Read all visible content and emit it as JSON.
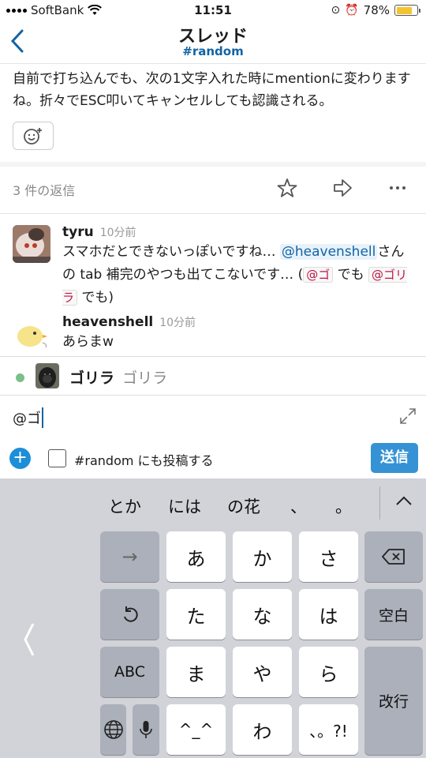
{
  "status_bar": {
    "carrier": "SoftBank",
    "time": "11:51",
    "battery": "78%"
  },
  "nav": {
    "title": "スレッド",
    "channel": "#random"
  },
  "parent_message": {
    "text": "自前で打ち込んでも、次の1文字入れた時にmentionに変わりますね。折々でESC叩いてキャンセルしても認識される。"
  },
  "thread_bar": {
    "reply_count": "3 件の返信"
  },
  "messages": [
    {
      "user": "tyru",
      "time": "10分前",
      "p1": "スマホだとできないっぽいですね… ",
      "mention": "@heavenshell",
      "p2": "さんの tab 補完のやつも出てこないです… (",
      "code1": "@ゴ",
      "p3": " でも ",
      "code2": "@ゴリラ",
      "p4": " でも)"
    },
    {
      "user": "heavenshell",
      "time": "10分前",
      "text": "あらまw"
    }
  ],
  "suggestion": {
    "display_name": "ゴリラ",
    "full_name": "ゴリラ"
  },
  "compose": {
    "text": "@ゴ",
    "also_post_label": "#random にも投稿する",
    "send_label": "送信"
  },
  "keyboard": {
    "candidates": [
      "とか",
      "には",
      "の花",
      "、",
      "。"
    ],
    "row1": [
      "→",
      "あ",
      "か",
      "さ"
    ],
    "row2": [
      "た",
      "な",
      "は",
      "空白"
    ],
    "row3": [
      "ABC",
      "ま",
      "や",
      "ら",
      "改行"
    ],
    "row4": [
      "^_^",
      "わ",
      "、。?!"
    ]
  }
}
